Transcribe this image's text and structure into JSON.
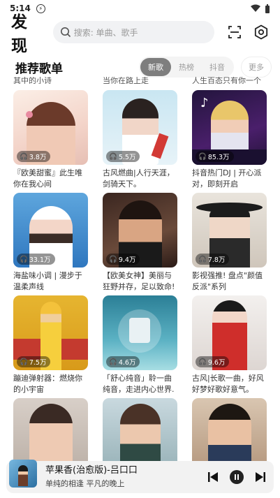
{
  "status": {
    "time": "5:14"
  },
  "header": {
    "logo": "发现",
    "search_placeholder": "搜索: 单曲、歌手"
  },
  "section": {
    "title": "推荐歌单",
    "tabs": [
      {
        "label": "新歌",
        "active": true
      },
      {
        "label": "热榜",
        "active": false
      },
      {
        "label": "抖音",
        "active": false
      }
    ],
    "more_label": "更多"
  },
  "remnants": [
    "其中的小诗",
    "当你在路上走",
    "人生百态只有你一个"
  ],
  "playlists": [
    {
      "count": "3.8万",
      "title": "『欧美甜蜜』此生唯你在我心间"
    },
    {
      "count": "5.5万",
      "title": "古风燃曲|人行天涯，剑骑天下。"
    },
    {
      "count": "85.3万",
      "title": "抖音热门DJ | 开心派对，即刻开启"
    },
    {
      "count": "33.1万",
      "title": "海盐味小调 | 漫步于温柔声线"
    },
    {
      "count": "9.4万",
      "title": "【欧美女神】美丽与狂野并存，足以致命!"
    },
    {
      "count": "7.8万",
      "title": "影视强推! 盘点\"颜值反派\"系列"
    },
    {
      "count": "7.5万",
      "title": "蹦迪弹射器：燃烧你的小宇宙"
    },
    {
      "count": "4.6万",
      "title": "「舒心纯音」聆一曲纯音，走进内心世界."
    },
    {
      "count": "9.6万",
      "title": "古风|长歌一曲，好风好梦好歌好意气。"
    },
    {
      "count": "",
      "title": ""
    },
    {
      "count": "",
      "title": ""
    },
    {
      "count": "",
      "title": ""
    }
  ],
  "player": {
    "title": "苹果香(治愈版)-吕口口",
    "subtitle": "单纯的相逢 平凡的晚上"
  }
}
